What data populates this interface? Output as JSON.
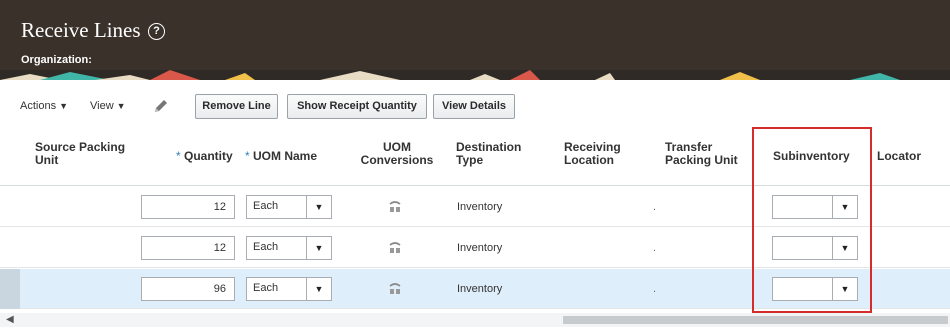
{
  "header": {
    "title": "Receive Lines",
    "help_icon": "help-circle-icon",
    "organization_label": "Organization:"
  },
  "toolbar": {
    "actions_label": "Actions",
    "view_label": "View",
    "edit_icon": "pencil-icon",
    "remove_line_label": "Remove Line",
    "show_receipt_quantity_label": "Show Receipt Quantity",
    "view_details_label": "View Details"
  },
  "columns": {
    "source_packing_unit": "Source Packing Unit",
    "required_marker": "*",
    "quantity": "Quantity",
    "uom_name": "UOM Name",
    "uom_conversions": "UOM Conversions",
    "destination_type": "Destination Type",
    "receiving_location": "Receiving Location",
    "transfer_packing_unit": "Transfer Packing Unit",
    "subinventory": "Subinventory",
    "locator": "Locator"
  },
  "rows": [
    {
      "quantity": "12",
      "uom": "Each",
      "destination_type": "Inventory",
      "transfer_packing_unit": ".",
      "subinventory": "",
      "selected": false
    },
    {
      "quantity": "12",
      "uom": "Each",
      "destination_type": "Inventory",
      "transfer_packing_unit": ".",
      "subinventory": "",
      "selected": false
    },
    {
      "quantity": "96",
      "uom": "Each",
      "destination_type": "Inventory",
      "transfer_packing_unit": ".",
      "subinventory": "",
      "selected": true
    }
  ],
  "colors": {
    "header_bg": "#3a312b",
    "required_marker": "#2e7fc1",
    "highlight_border": "#d62b2b",
    "selected_row": "#dfeefb"
  }
}
